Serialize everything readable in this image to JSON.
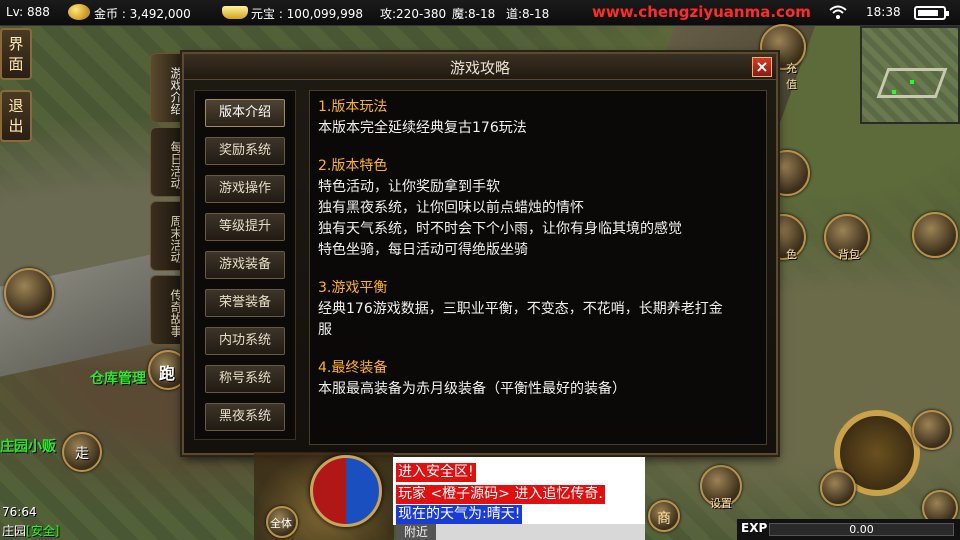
{
  "status_bar": {
    "level": "Lv: 888",
    "gold_label": "金币 : 3,492,000",
    "yuanbao_label": "元宝 : 100,099,998",
    "attack": "攻:220-380",
    "magic": "魔:8-18",
    "tao": "道:8-18",
    "url": "www.chengziyuanma.com",
    "time": "18:38",
    "battery_level": 0.85
  },
  "side_buttons": {
    "interface": "界面",
    "exit": "退出"
  },
  "npc": {
    "warehouse": "仓库管理",
    "manor_vendor": "庄园小贩",
    "run": "跑",
    "walk": "走"
  },
  "hud_labels": {
    "recharge": "充值",
    "role": "色",
    "bag": "背包",
    "settings": "设置",
    "shop": "商",
    "all": "全体"
  },
  "dialog": {
    "title": "游戏攻略",
    "close": "×",
    "vertical_tabs": [
      "游戏介绍",
      "每日活动",
      "周末活动",
      "传奇故事"
    ],
    "menu": [
      "版本介绍",
      "奖励系统",
      "游戏操作",
      "等级提升",
      "游戏装备",
      "荣誉装备",
      "内功系统",
      "称号系统",
      "黑夜系统"
    ],
    "sections": [
      {
        "title": "1.版本玩法",
        "lines": [
          "本版本完全延续经典复古176玩法"
        ]
      },
      {
        "title": "2.版本特色",
        "lines": [
          "特色活动，让你奖励拿到手软",
          "独有黑夜系统，让你回味以前点蜡烛的情怀",
          "独有天气系统，时不时会下个小雨，让你有身临其境的感觉",
          "特色坐骑，每日活动可得绝版坐骑"
        ]
      },
      {
        "title": "3.游戏平衡",
        "lines": [
          "经典176游戏数据，三职业平衡，不变态，不花哨，长期养老打金",
          "服"
        ]
      },
      {
        "title": "4.最终装备",
        "lines": [
          "本服最高装备为赤月级装备（平衡性最好的装备）"
        ]
      }
    ]
  },
  "chat": {
    "lines": [
      "进入安全区!",
      "玩家 <橙子源码> 进入追忆传奇.",
      "现在的天气为:晴天!"
    ],
    "colors": [
      "#e01010",
      "#e01010",
      "#1a3cd6"
    ],
    "tab": "附近"
  },
  "location": {
    "coords": "76:64",
    "map": "庄园",
    "safe": "[安全]"
  },
  "exp": {
    "label": "EXP",
    "value": "0.00"
  }
}
